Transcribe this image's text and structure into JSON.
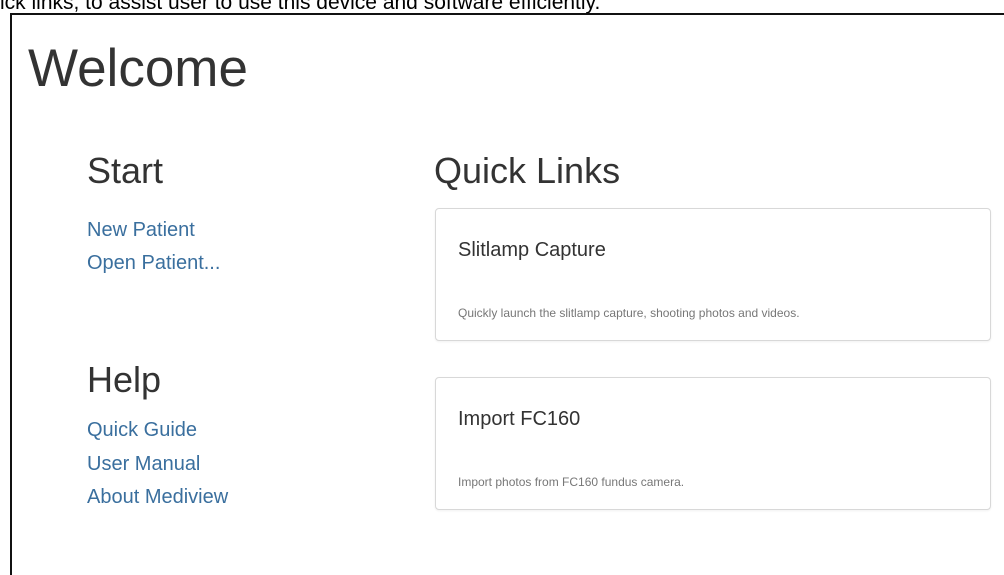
{
  "caption": "ick links, to assist user to use this device and software efficiently.",
  "page_title": "Welcome",
  "start": {
    "heading": "Start",
    "links": [
      "New Patient",
      "Open Patient..."
    ]
  },
  "help": {
    "heading": "Help",
    "links": [
      "Quick Guide",
      "User Manual",
      "About Mediview"
    ]
  },
  "quick_links": {
    "heading": "Quick Links",
    "cards": [
      {
        "title": "Slitlamp Capture",
        "description": "Quickly launch the slitlamp capture, shooting photos and videos."
      },
      {
        "title": "Import FC160",
        "description": "Import photos from FC160 fundus camera."
      }
    ]
  }
}
